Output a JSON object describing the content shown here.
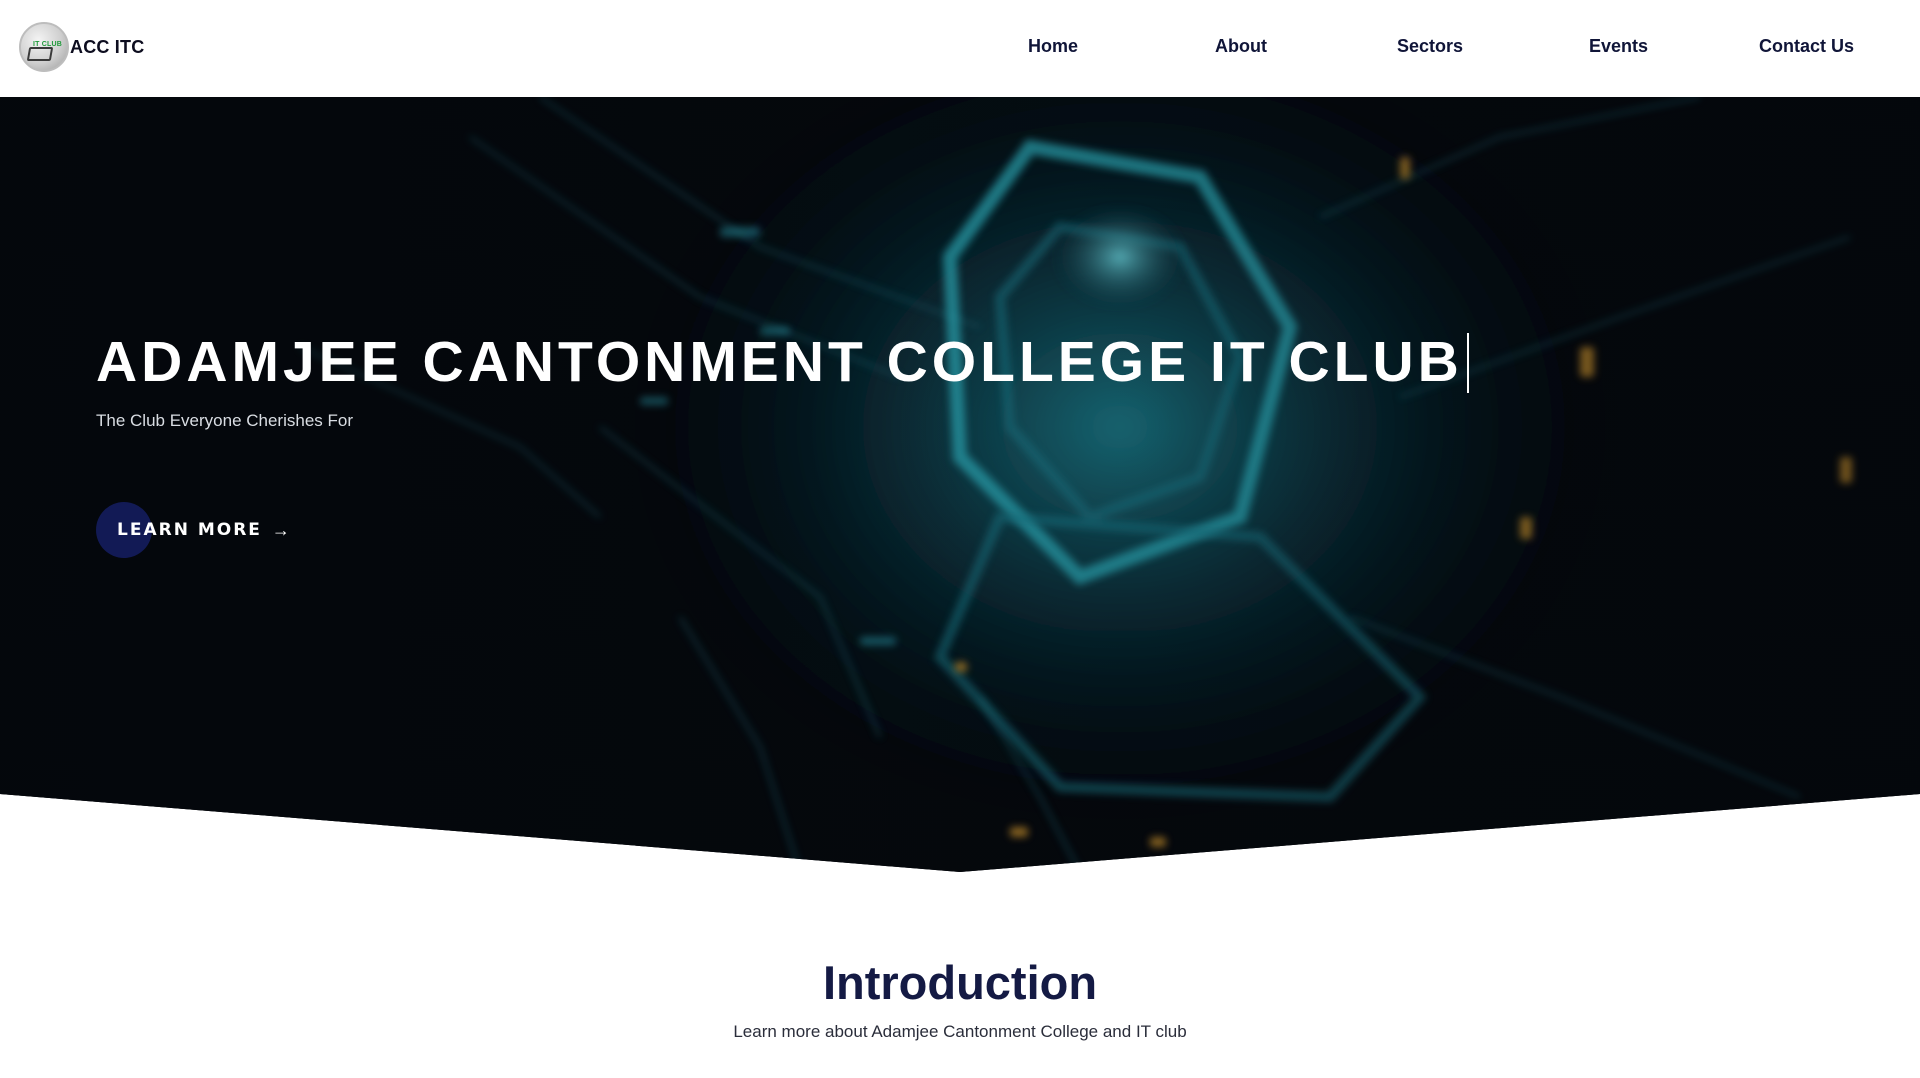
{
  "brand": {
    "name": "ACC ITC",
    "logo_text": "IT CLUB",
    "logo_icon": "it-club-logo"
  },
  "nav": {
    "items": [
      {
        "label": "Home"
      },
      {
        "label": "About"
      },
      {
        "label": "Sectors"
      },
      {
        "label": "Events"
      },
      {
        "label": "Contact Us"
      }
    ]
  },
  "hero": {
    "title": "ADAMJEE CANTONMENT COLLEGE IT CLUB",
    "subtitle": "The Club Everyone Cherishes For",
    "cta_label": "LEARN MORE",
    "cta_icon": "arrow-right-icon",
    "background": "abstract circuit hexagon illustration"
  },
  "intro": {
    "title": "Introduction",
    "subtitle": "Learn more about Adamjee Cantonment College and IT club"
  },
  "colors": {
    "nav_text": "#101538",
    "hero_bg": "#04070c",
    "accent_teal": "#2fb6c4",
    "cta_circle": "#121a55",
    "intro_title": "#141a44"
  }
}
